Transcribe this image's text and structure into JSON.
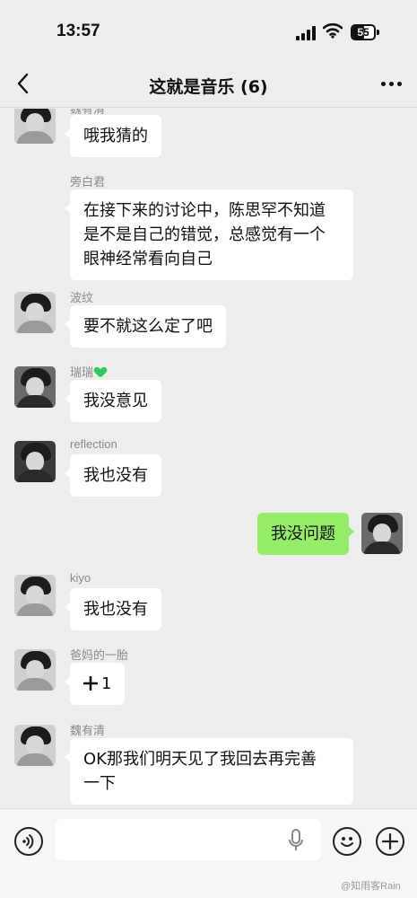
{
  "status_bar": {
    "time": "13:57",
    "battery": "55",
    "battery_level": 0.55
  },
  "header": {
    "title": "这就是音乐 (6)"
  },
  "messages": [
    {
      "sender": "魏有清",
      "text": "哦我猜的",
      "avatar": "avatar-icon"
    },
    {
      "sender": "旁白君",
      "text": "在接下来的讨论中，陈思罕不知道是不是自己的错觉，总感觉有一个眼神经常看向自己",
      "text_lines": [
        "在接下来的讨论中，陈思罕不知道",
        "是不是自己的错觉，总感觉有一个",
        "眼神经常看向自己"
      ]
    },
    {
      "sender": "波纹",
      "text": "要不就这么定了吧",
      "avatar": "avatar-icon"
    },
    {
      "sender": "瑞瑞",
      "sender_icon": "green-heart-icon",
      "text": "我没意见",
      "avatar": "avatar-icon"
    },
    {
      "sender": "reflection",
      "text": "我也没有",
      "avatar": "avatar-icon"
    },
    {
      "sender": "",
      "text": "我没问题",
      "mine": true,
      "avatar": "avatar-icon"
    },
    {
      "sender": "kiyo",
      "text": "我也没有",
      "avatar": "avatar-icon"
    },
    {
      "sender": "爸妈的一胎",
      "text": "1",
      "prefix_icon": "plus-icon",
      "avatar": "avatar-icon"
    },
    {
      "sender": "魏有清",
      "text": "OK那我们明天见了我回去再完善一下",
      "text_lines": [
        "OK那我们明天见了我回去再完善",
        "一下"
      ],
      "avatar": "avatar-icon"
    }
  ],
  "input_bar": {
    "placeholder": "",
    "icons": [
      "voice-icon",
      "microphone-icon",
      "emoji-icon",
      "plus-icon"
    ]
  },
  "watermark": "@知雨客Rain",
  "colors": {
    "background": "#ededed",
    "bubble_other": "#ffffff",
    "bubble_mine": "#95ec69"
  }
}
